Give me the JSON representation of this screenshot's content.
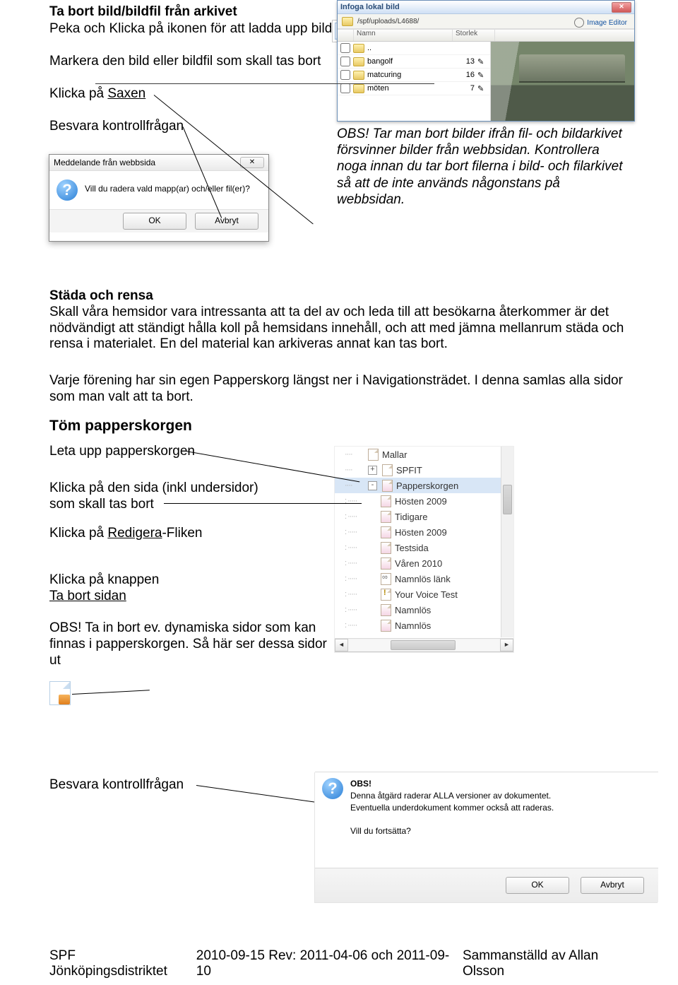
{
  "heading1": "Ta bort bild/bildfil från arkivet",
  "line_peka": "Peka och Klicka på ikonen för att ladda upp bild",
  "line_markera": "Markera den bild eller bildfil som skall tas bort",
  "line_klicka_prefix": "Klicka på ",
  "line_klicka_link": "Saxen",
  "line_besvara": "Besvara kontrollfrågan",
  "obs_text": "OBS! Tar man bort bilder ifrån fil- och bildarkivet försvinner bilder från webbsidan. Kontrollera noga innan du tar bort filerna i bild- och filarkivet så att de inte används någonstans på webbsidan.",
  "stada_heading": "Städa och rensa",
  "stada_para": "Skall våra hemsidor vara intressanta att ta del av och leda till att besökarna återkommer är det nödvändigt att ständigt hålla koll på hemsidans innehåll, och att med jämna mellanrum städa och rensa i materialet. En del material kan arkiveras annat kan tas bort.",
  "varje_para": "Varje förening har sin egen Papperskorg längst ner i Navigationsträdet. I denna samlas alla sidor som man valt att ta bort.",
  "tom_heading": "Töm papperskorgen",
  "leta": "Leta upp papperskorgen",
  "klicka_sida": "Klicka på den sida (inkl undersidor) som skall tas bort",
  "klicka_redigera_prefix": "Klicka på ",
  "klicka_redigera_link": "Redigera",
  "klicka_redigera_suffix": "-Fliken",
  "klicka_knappen": "Klicka på knappen",
  "ta_bort_sidan": "Ta bort sidan",
  "obs_dyn": "OBS! Ta in bort ev. dynamiska sidor som kan finnas i papperskorgen. Så här ser dessa sidor ut",
  "besvara2": "Besvara kontrollfrågan",
  "footer_left": "SPF Jönköpingsdistriktet",
  "footer_mid": "2010-09-15  Rev: 2011-04-06 och 2011-09-10",
  "footer_right": "Sammanställd av Allan Olsson",
  "infoga": {
    "title": "Infoga lokal bild",
    "path": "/spf/uploads/L4688/",
    "col_name": "Namn",
    "col_size": "Storlek",
    "image_editor": "Image Editor",
    "files": [
      {
        "name": "..",
        "size": ""
      },
      {
        "name": "bangolf",
        "size": "13"
      },
      {
        "name": "matcuring",
        "size": "16"
      },
      {
        "name": "möten",
        "size": "7"
      }
    ]
  },
  "msg1": {
    "title": "Meddelande från webbsida",
    "text": "Vill du radera vald mapp(ar) och/eller fil(er)?",
    "ok": "OK",
    "cancel": "Avbryt"
  },
  "tree": {
    "items": [
      {
        "label": "Mallar",
        "level": 1,
        "icon": "page"
      },
      {
        "label": "SPFIT",
        "level": 1,
        "icon": "page",
        "expander": "+"
      },
      {
        "label": "Papperskorgen",
        "level": 1,
        "icon": "page-pink",
        "selected": true,
        "expander": "-"
      },
      {
        "label": "Hösten 2009",
        "level": 2,
        "icon": "page-pink"
      },
      {
        "label": "Tidigare",
        "level": 2,
        "icon": "page-pink"
      },
      {
        "label": "Hösten 2009",
        "level": 2,
        "icon": "page-pink"
      },
      {
        "label": "Testsida",
        "level": 2,
        "icon": "page-pink"
      },
      {
        "label": "Våren 2010",
        "level": 2,
        "icon": "page-pink"
      },
      {
        "label": "Namnlös länk",
        "level": 2,
        "icon": "link"
      },
      {
        "label": "Your Voice Test",
        "level": 2,
        "icon": "warn"
      },
      {
        "label": "Namnlös",
        "level": 2,
        "icon": "page-pink"
      },
      {
        "label": "Namnlös",
        "level": 2,
        "icon": "page-pink"
      }
    ]
  },
  "obs2": {
    "heading": "OBS!",
    "line1": "Denna åtgärd raderar ALLA versioner av dokumentet.",
    "line2": "Eventuella underdokument kommer också att raderas.",
    "question": "Vill du fortsätta?",
    "ok": "OK",
    "cancel": "Avbryt"
  }
}
